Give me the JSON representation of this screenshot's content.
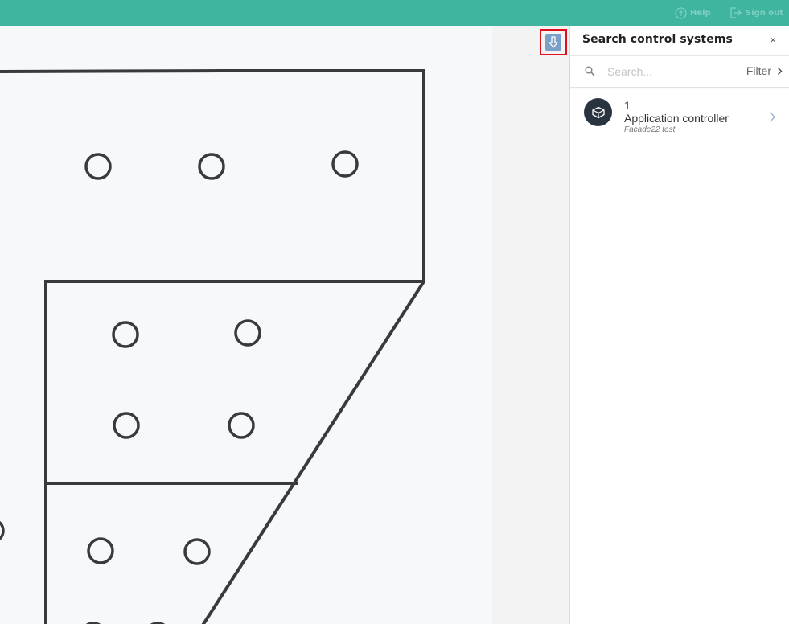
{
  "header": {
    "help_label": "Help",
    "signout_label": "Sign out"
  },
  "panel": {
    "title": "Search control systems",
    "close_label": "×",
    "search_placeholder": "Search...",
    "filter_label": "Filter",
    "results": [
      {
        "number": "1",
        "title": "Application controller",
        "subtitle": "Facade22 test"
      }
    ]
  },
  "colors": {
    "topbar": "#3fb49f",
    "highlight": "#e0101a",
    "avatar": "#2a3441",
    "export_button": "#7aa0c8"
  },
  "icons": {
    "help": "help-circle-icon",
    "signout": "sign-out-icon",
    "export": "arrow-down-icon",
    "search": "search-icon",
    "filter": "chevron-right-icon",
    "result": "box-icon"
  }
}
